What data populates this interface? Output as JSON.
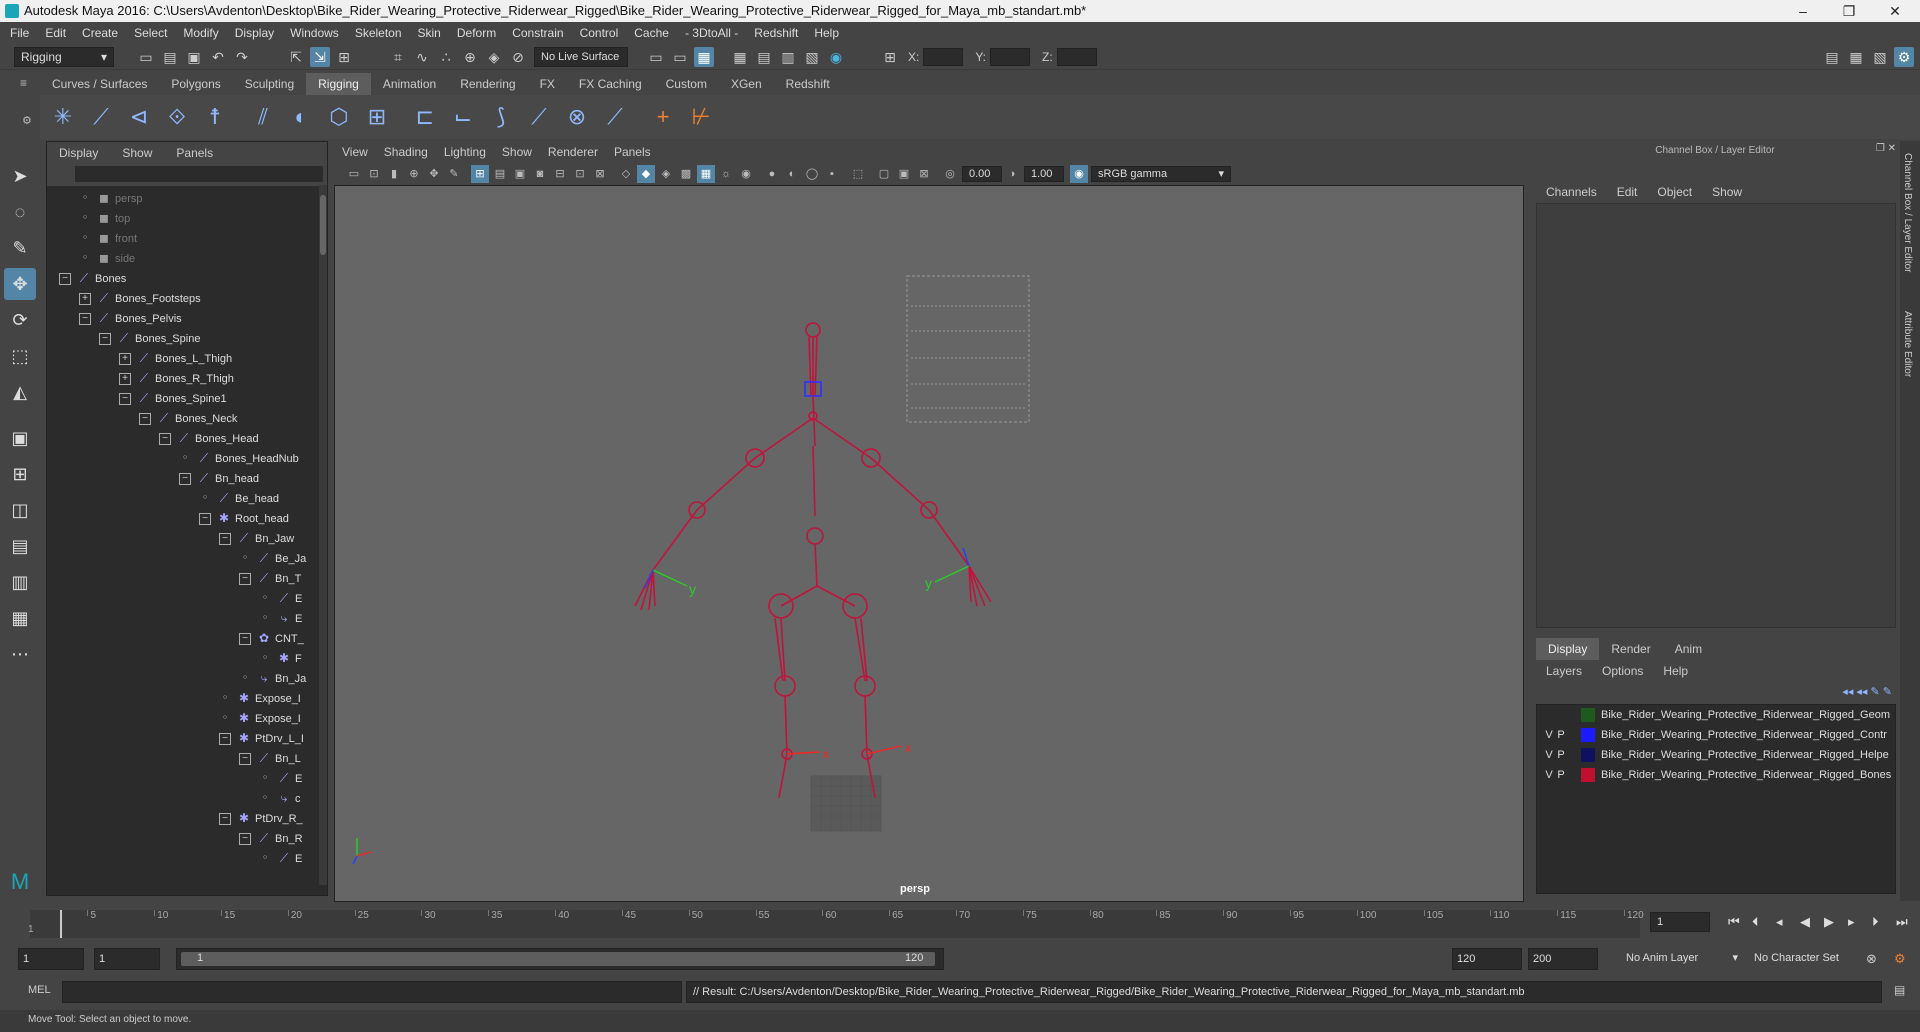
{
  "window": {
    "title": "Autodesk Maya 2016: C:\\Users\\Avdenton\\Desktop\\Bike_Rider_Wearing_Protective_Riderwear_Rigged\\Bike_Rider_Wearing_Protective_Riderwear_Rigged_for_Maya_mb_standart.mb*",
    "minimize": "–",
    "maximize": "❐",
    "close": "✕"
  },
  "menubar": [
    "File",
    "Edit",
    "Create",
    "Select",
    "Modify",
    "Display",
    "Windows",
    "Skeleton",
    "Skin",
    "Deform",
    "Constrain",
    "Control",
    "Cache",
    "- 3DtoAll -",
    "Redshift",
    "Help"
  ],
  "statusline": {
    "menuset": "Rigging",
    "live_surface": "No Live Surface",
    "x_label": "X:",
    "y_label": "Y:",
    "z_label": "Z:"
  },
  "shelf": {
    "tabs": [
      "Curves / Surfaces",
      "Polygons",
      "Sculpting",
      "Rigging",
      "Animation",
      "Rendering",
      "FX",
      "FX Caching",
      "Custom",
      "XGen",
      "Redshift"
    ],
    "active_tab": "Rigging"
  },
  "outliner": {
    "menu": [
      "Display",
      "Show",
      "Panels"
    ],
    "items": [
      {
        "label": "persp",
        "depth": 1,
        "icon": "camera-icon",
        "dim": true,
        "exp": ""
      },
      {
        "label": "top",
        "depth": 1,
        "icon": "camera-icon",
        "dim": true,
        "exp": ""
      },
      {
        "label": "front",
        "depth": 1,
        "icon": "camera-icon",
        "dim": true,
        "exp": ""
      },
      {
        "label": "side",
        "depth": 1,
        "icon": "camera-icon",
        "dim": true,
        "exp": ""
      },
      {
        "label": "Bones",
        "depth": 0,
        "icon": "joint-icon",
        "exp": "−"
      },
      {
        "label": "Bones_Footsteps",
        "depth": 1,
        "icon": "joint-icon",
        "exp": "+"
      },
      {
        "label": "Bones_Pelvis",
        "depth": 1,
        "icon": "joint-icon",
        "exp": "−"
      },
      {
        "label": "Bones_Spine",
        "depth": 2,
        "icon": "joint-icon",
        "exp": "−"
      },
      {
        "label": "Bones_L_Thigh",
        "depth": 3,
        "icon": "joint-icon",
        "exp": "+"
      },
      {
        "label": "Bones_R_Thigh",
        "depth": 3,
        "icon": "joint-icon",
        "exp": "+"
      },
      {
        "label": "Bones_Spine1",
        "depth": 3,
        "icon": "joint-icon",
        "exp": "−"
      },
      {
        "label": "Bones_Neck",
        "depth": 4,
        "icon": "joint-icon",
        "exp": "−"
      },
      {
        "label": "Bones_Head",
        "depth": 5,
        "icon": "joint-icon",
        "exp": "−"
      },
      {
        "label": "Bones_HeadNub",
        "depth": 6,
        "icon": "joint-icon",
        "exp": ""
      },
      {
        "label": "Bn_head",
        "depth": 6,
        "icon": "joint-icon",
        "exp": "−"
      },
      {
        "label": "Be_head",
        "depth": 7,
        "icon": "joint-icon",
        "exp": ""
      },
      {
        "label": "Root_head",
        "depth": 7,
        "icon": "locator-icon",
        "exp": "−"
      },
      {
        "label": "Bn_Jaw",
        "depth": 8,
        "icon": "joint-icon",
        "exp": "−"
      },
      {
        "label": "Be_Ja",
        "depth": 9,
        "icon": "joint-icon",
        "exp": ""
      },
      {
        "label": "Bn_T",
        "depth": 9,
        "icon": "joint-icon",
        "exp": "−"
      },
      {
        "label": "E",
        "depth": 10,
        "icon": "joint-icon",
        "exp": ""
      },
      {
        "label": "E",
        "depth": 10,
        "icon": "ik-icon",
        "exp": ""
      },
      {
        "label": "CNT_",
        "depth": 9,
        "icon": "control-icon",
        "exp": "−"
      },
      {
        "label": "F",
        "depth": 10,
        "icon": "locator-icon",
        "exp": ""
      },
      {
        "label": "Bn_Ja",
        "depth": 9,
        "icon": "ik-icon",
        "exp": ""
      },
      {
        "label": "Expose_I",
        "depth": 8,
        "icon": "locator-icon",
        "exp": ""
      },
      {
        "label": "Expose_I",
        "depth": 8,
        "icon": "locator-icon",
        "exp": ""
      },
      {
        "label": "PtDrv_L_I",
        "depth": 8,
        "icon": "locator-icon",
        "exp": "−"
      },
      {
        "label": "Bn_L",
        "depth": 9,
        "icon": "joint-icon",
        "exp": "−"
      },
      {
        "label": "E",
        "depth": 10,
        "icon": "joint-icon",
        "exp": ""
      },
      {
        "label": "c",
        "depth": 10,
        "icon": "ik-icon",
        "exp": ""
      },
      {
        "label": "PtDrv_R_",
        "depth": 8,
        "icon": "locator-icon",
        "exp": "−"
      },
      {
        "label": "Bn_R",
        "depth": 9,
        "icon": "joint-icon",
        "exp": "−"
      },
      {
        "label": "E",
        "depth": 10,
        "icon": "joint-icon",
        "exp": ""
      }
    ]
  },
  "viewport": {
    "menu": [
      "View",
      "Shading",
      "Lighting",
      "Show",
      "Renderer",
      "Panels"
    ],
    "exposure": "0.00",
    "gamma": "1.00",
    "color_space": "sRGB gamma",
    "camera_label": "persp",
    "axis_x": "x",
    "axis_y": "y",
    "axis_z": "z"
  },
  "channelbox": {
    "header": "Channel Box / Layer Editor",
    "menu": [
      "Channels",
      "Edit",
      "Object",
      "Show"
    ],
    "layer_tabs": [
      "Display",
      "Render",
      "Anim"
    ],
    "active_layer_tab": "Display",
    "layer_menu": [
      "Layers",
      "Options",
      "Help"
    ],
    "layers": [
      {
        "v": "",
        "p": "",
        "color": "#1e5a1e",
        "name": "Bike_Rider_Wearing_Protective_Riderwear_Rigged_Geom"
      },
      {
        "v": "V",
        "p": "P",
        "color": "#1a1aff",
        "name": "Bike_Rider_Wearing_Protective_Riderwear_Rigged_Contr"
      },
      {
        "v": "V",
        "p": "P",
        "color": "#101060",
        "name": "Bike_Rider_Wearing_Protective_Riderwear_Rigged_Helpe"
      },
      {
        "v": "V",
        "p": "P",
        "color": "#c01030",
        "name": "Bike_Rider_Wearing_Protective_Riderwear_Rigged_Bones"
      }
    ],
    "side_tab_1": "Channel Box / Layer Editor",
    "side_tab_2": "Attribute Editor"
  },
  "timeslider": {
    "ticks": [
      "5",
      "10",
      "15",
      "20",
      "25",
      "30",
      "35",
      "40",
      "45",
      "50",
      "55",
      "60",
      "65",
      "70",
      "75",
      "80",
      "85",
      "90",
      "95",
      "100",
      "105",
      "110",
      "115",
      "120"
    ],
    "start_marker": "1",
    "current_frame": "1"
  },
  "rangeslider": {
    "start": "1",
    "playback_start": "1",
    "range_start_label": "1",
    "range_end_label": "120",
    "playback_end": "120",
    "end": "200",
    "anim_layer": "No Anim Layer",
    "character_set": "No Character Set"
  },
  "commandline": {
    "label": "MEL",
    "result": "// Result: C:/Users/Avdenton/Desktop/Bike_Rider_Wearing_Protective_Riderwear_Rigged/Bike_Rider_Wearing_Protective_Riderwear_Rigged_for_Maya_mb_standart.mb"
  },
  "helpline": "Move Tool: Select an object to move."
}
